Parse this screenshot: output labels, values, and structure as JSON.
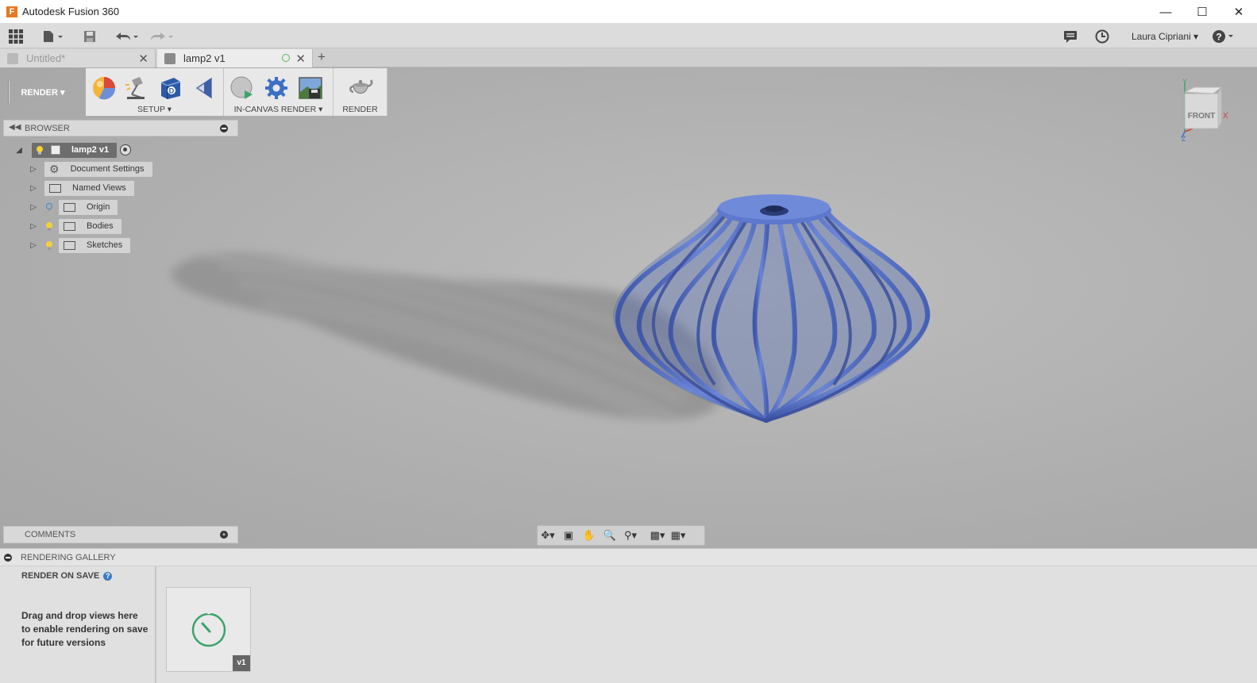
{
  "window": {
    "title": "Autodesk Fusion 360",
    "logo_letter": "F"
  },
  "quick_access": {
    "user_name": "Laura Cipriani ▾"
  },
  "tabs": [
    {
      "label": "Untitled*",
      "active": false
    },
    {
      "label": "lamp2 v1",
      "active": true
    }
  ],
  "toolbar": {
    "workspace": "RENDER ▾",
    "setup_caption": "SETUP ▾",
    "in_canvas_caption": "IN-CANVAS RENDER ▾",
    "render_caption": "RENDER"
  },
  "browser": {
    "title": "BROWSER",
    "root": "lamp2 v1",
    "items": [
      {
        "label": "Document Settings"
      },
      {
        "label": "Named Views"
      },
      {
        "label": "Origin"
      },
      {
        "label": "Bodies"
      },
      {
        "label": "Sketches"
      }
    ]
  },
  "comments": {
    "title": "COMMENTS"
  },
  "viewcube": {
    "face_label": "FRONT",
    "axis_x": "X",
    "axis_y": "Y",
    "axis_z": "Z"
  },
  "gallery": {
    "title": "RENDERING GALLERY",
    "render_on_save": "RENDER ON SAVE",
    "help_glyph": "?",
    "hint": "Drag and drop views here to enable rendering on save for future versions",
    "thumb_version": "v1"
  },
  "colors": {
    "model_blue": "#5b76c8",
    "accent_orange": "#e87722",
    "progress_green": "#3aa46a"
  }
}
